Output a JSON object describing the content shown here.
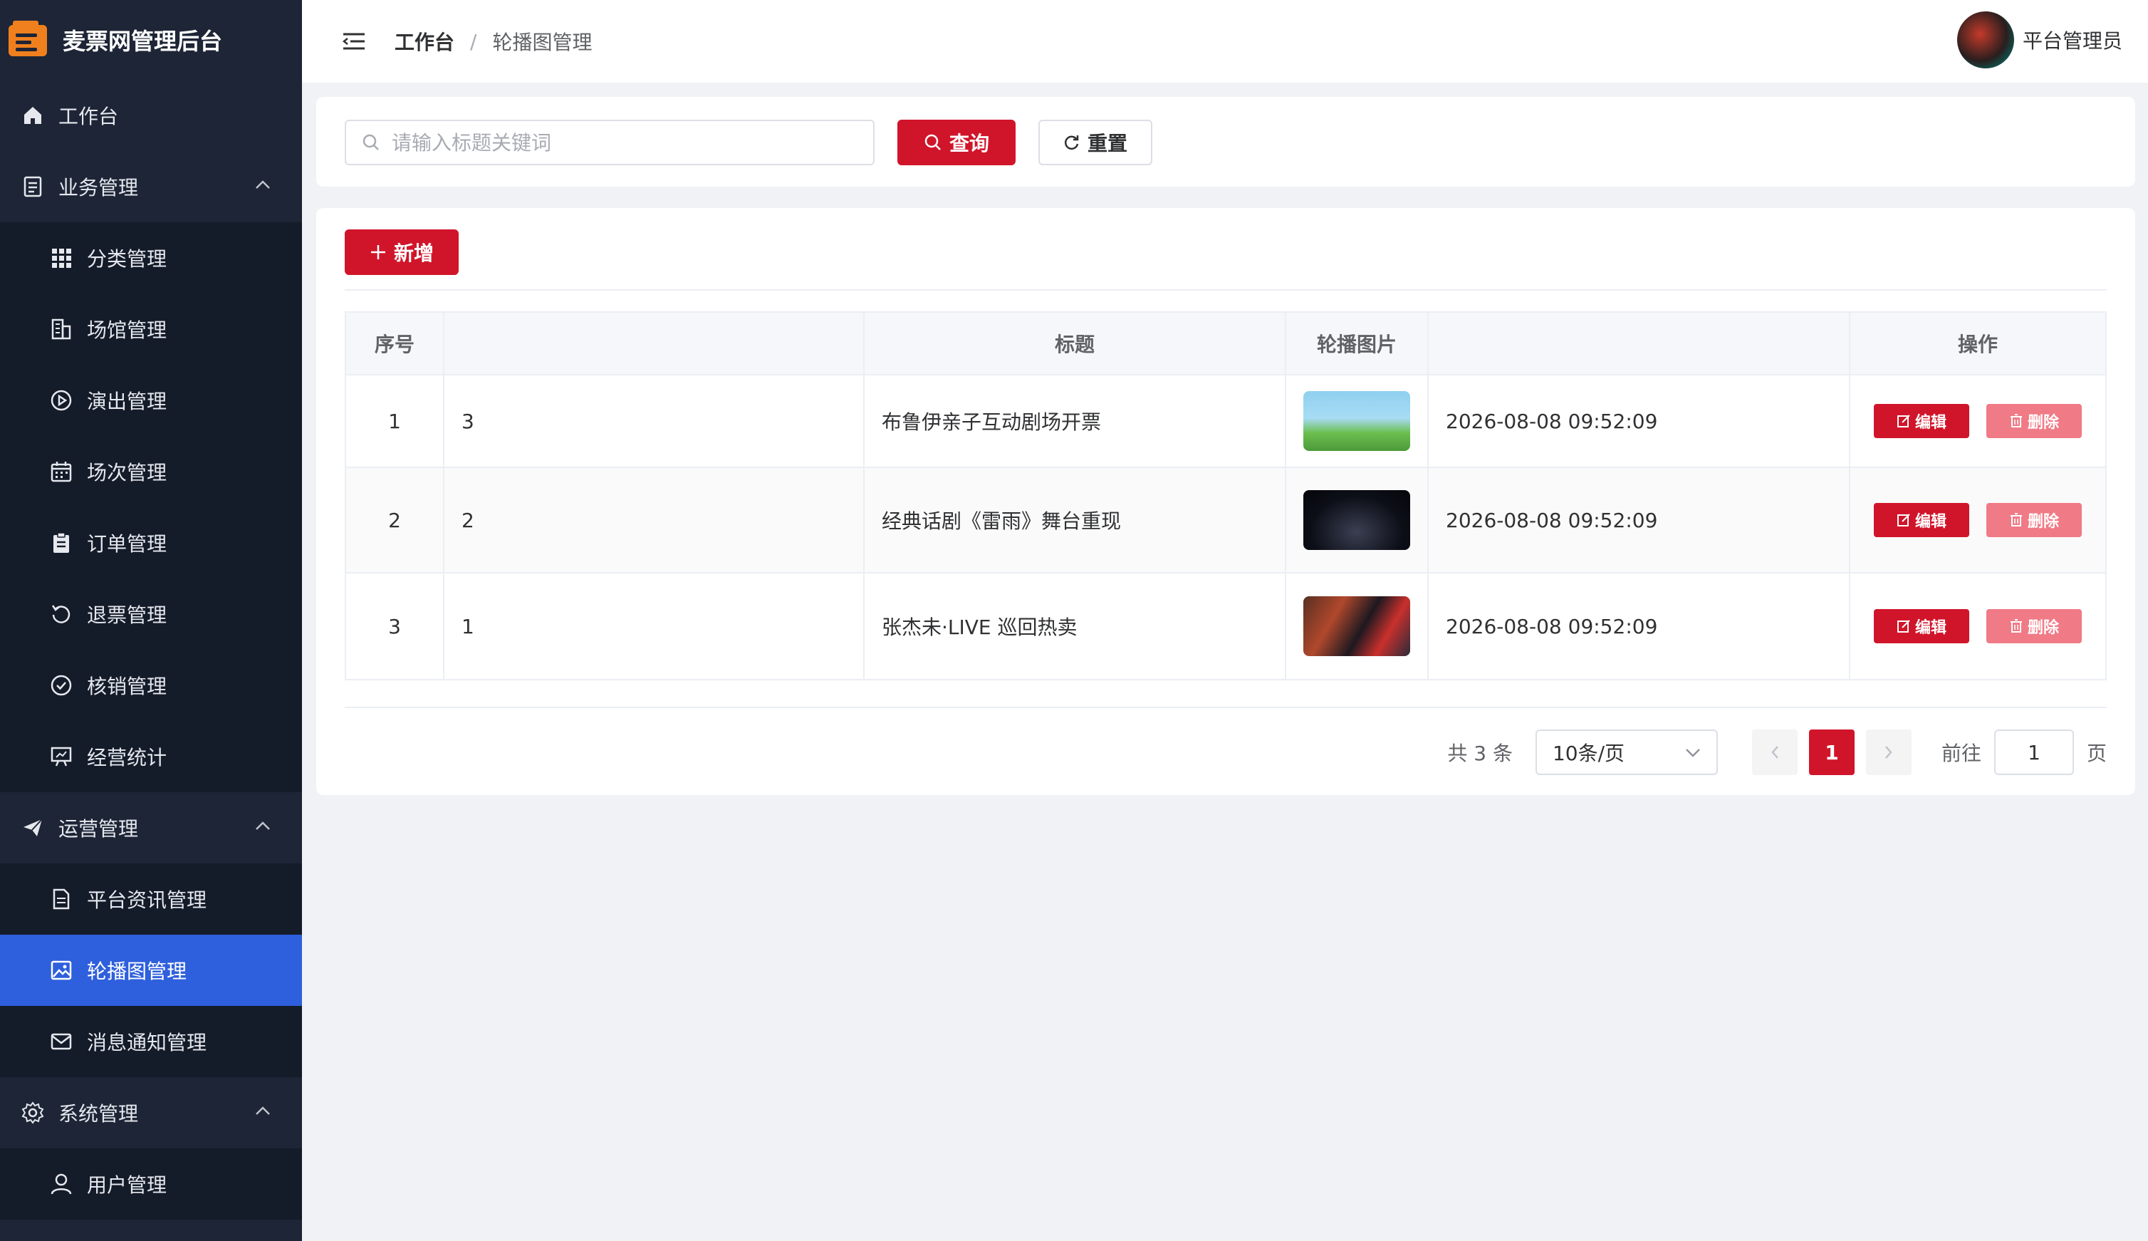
{
  "app": {
    "title": "麦票网管理后台"
  },
  "colors": {
    "brand": "#d0152a",
    "sidebar_bg": "#1d2536",
    "active_menu": "#2e5fdc"
  },
  "sidebar": {
    "items": [
      {
        "label": "工作台",
        "icon": "home-icon",
        "level": "top"
      },
      {
        "label": "业务管理",
        "icon": "document-icon",
        "level": "top",
        "expanded": true
      },
      {
        "label": "分类管理",
        "icon": "grid-icon",
        "level": "sub"
      },
      {
        "label": "场馆管理",
        "icon": "building-icon",
        "level": "sub"
      },
      {
        "label": "演出管理",
        "icon": "play-icon",
        "level": "sub"
      },
      {
        "label": "场次管理",
        "icon": "calendar-icon",
        "level": "sub"
      },
      {
        "label": "订单管理",
        "icon": "clipboard-icon",
        "level": "sub"
      },
      {
        "label": "退票管理",
        "icon": "refresh-icon",
        "level": "sub"
      },
      {
        "label": "核销管理",
        "icon": "check-circle-icon",
        "level": "sub"
      },
      {
        "label": "经营统计",
        "icon": "presentation-icon",
        "level": "sub"
      },
      {
        "label": "运营管理",
        "icon": "paper-plane-icon",
        "level": "top",
        "expanded": true
      },
      {
        "label": "平台资讯管理",
        "icon": "document-icon",
        "level": "sub"
      },
      {
        "label": "轮播图管理",
        "icon": "picture-icon",
        "level": "sub",
        "active": true
      },
      {
        "label": "消息通知管理",
        "icon": "message-icon",
        "level": "sub"
      },
      {
        "label": "系统管理",
        "icon": "gear-icon",
        "level": "top",
        "expanded": true
      },
      {
        "label": "用户管理",
        "icon": "user-icon",
        "level": "sub"
      }
    ]
  },
  "header": {
    "breadcrumb_home": "工作台",
    "breadcrumb_sep": "/",
    "breadcrumb_current": "轮播图管理",
    "user_name": "平台管理员"
  },
  "search": {
    "placeholder": "请输入标题关键词",
    "value": "",
    "query_label": "查询",
    "reset_label": "重置"
  },
  "toolbar": {
    "add_label": "新增"
  },
  "table": {
    "columns": [
      "序号",
      "",
      "标题",
      "轮播图片",
      "",
      "操作"
    ],
    "rows": [
      {
        "index": "1",
        "sort": "3",
        "title": "布鲁伊亲子互动剧场开票",
        "time": "2026-08-08 09:52:09"
      },
      {
        "index": "2",
        "sort": "2",
        "title": "经典话剧《雷雨》舞台重现",
        "time": "2026-08-08 09:52:09"
      },
      {
        "index": "3",
        "sort": "1",
        "title": "张杰未·LIVE 巡回热卖",
        "time": "2026-08-08 09:52:09"
      }
    ],
    "edit_label": "编辑",
    "delete_label": "删除"
  },
  "pagination": {
    "total_text": "共 3 条",
    "page_size": "10条/页",
    "current_page": "1",
    "goto_label": "前往",
    "goto_value": "1",
    "page_unit": "页"
  }
}
